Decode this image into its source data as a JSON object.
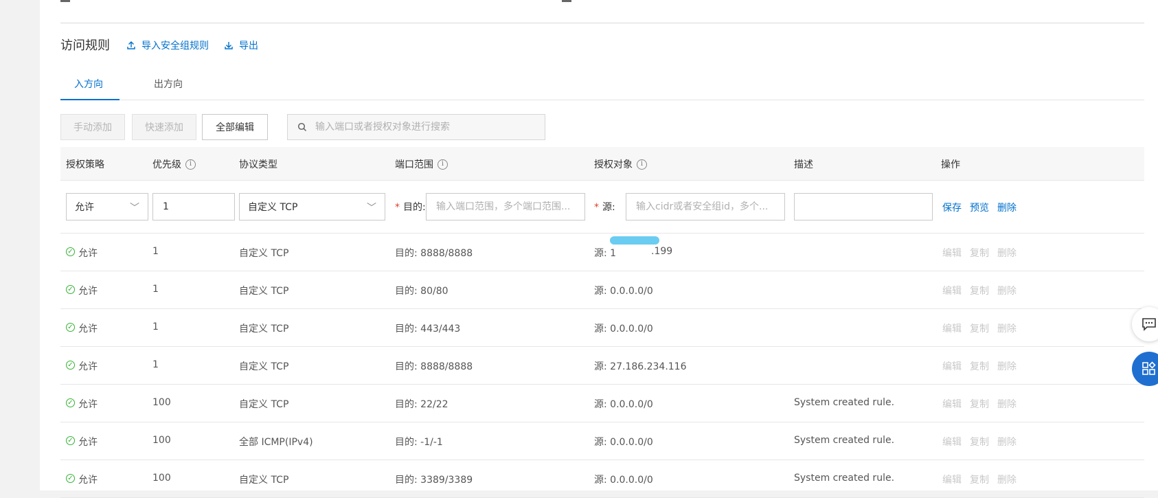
{
  "section": {
    "title": "访问规则",
    "import_link": "导入安全组规则",
    "export_link": "导出"
  },
  "tabs": [
    {
      "label": "入方向",
      "active": true
    },
    {
      "label": "出方向",
      "active": false
    }
  ],
  "toolbar": {
    "manual_add": "手动添加",
    "quick_add": "快速添加",
    "edit_all": "全部编辑",
    "search_placeholder": "输入端口或者授权对象进行搜索"
  },
  "table": {
    "headers": [
      "授权策略",
      "优先级",
      "协议类型",
      "端口范围",
      "授权对象",
      "描述",
      "操作"
    ],
    "edit_row": {
      "policy": "允许",
      "priority": "1",
      "protocol": "自定义 TCP",
      "dest_label": "目的:",
      "dest_placeholder": "输入端口范围，多个端口范围...",
      "source_label": "源:",
      "source_placeholder": "输入cidr或者安全组id，多个...",
      "description": "",
      "actions": [
        "保存",
        "预览",
        "删除"
      ]
    },
    "rows": [
      {
        "policy": "允许",
        "priority": "1",
        "protocol": "自定义 TCP",
        "port": "目的: 8888/8888",
        "source": "源: 1",
        "source_tail": ".199",
        "desc": ""
      },
      {
        "policy": "允许",
        "priority": "1",
        "protocol": "自定义 TCP",
        "port": "目的: 80/80",
        "source": "源: 0.0.0.0/0",
        "desc": ""
      },
      {
        "policy": "允许",
        "priority": "1",
        "protocol": "自定义 TCP",
        "port": "目的: 443/443",
        "source": "源: 0.0.0.0/0",
        "desc": ""
      },
      {
        "policy": "允许",
        "priority": "1",
        "protocol": "自定义 TCP",
        "port": "目的: 8888/8888",
        "source": "源: 27.186.234.116",
        "desc": ""
      },
      {
        "policy": "允许",
        "priority": "100",
        "protocol": "自定义 TCP",
        "port": "目的: 22/22",
        "source": "源: 0.0.0.0/0",
        "desc": "System created rule."
      },
      {
        "policy": "允许",
        "priority": "100",
        "protocol": "全部 ICMP(IPv4)",
        "port": "目的: -1/-1",
        "source": "源: 0.0.0.0/0",
        "desc": "System created rule."
      },
      {
        "policy": "允许",
        "priority": "100",
        "protocol": "自定义 TCP",
        "port": "目的: 3389/3389",
        "source": "源: 0.0.0.0/0",
        "desc": "System created rule."
      }
    ],
    "row_actions": [
      "编辑",
      "复制",
      "删除"
    ]
  },
  "colors": {
    "accent": "#0070cc",
    "ok": "#33b233",
    "required": "#e0402f",
    "float_button": "#1f6fd1"
  },
  "icons": {
    "import": "upload-icon",
    "export": "download-icon",
    "search": "search-icon",
    "info": "info-icon",
    "status": "check-circle-icon",
    "chat": "chat-icon",
    "apps": "apps-icon",
    "collapse": "chevron-left-icon"
  }
}
